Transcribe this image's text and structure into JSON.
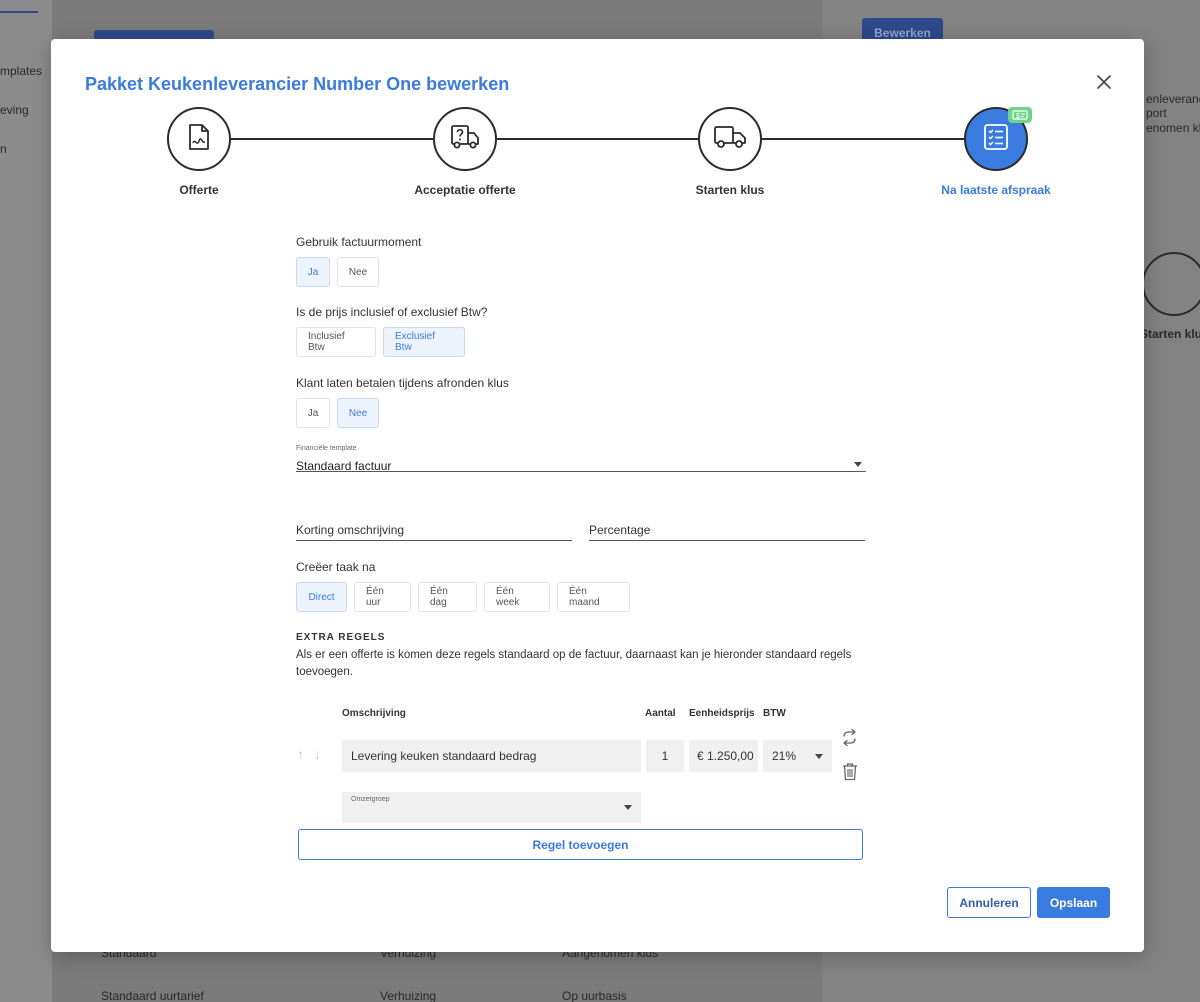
{
  "background": {
    "left_items": [
      "mplates",
      "eving",
      "n"
    ],
    "edit_button": "Bewerken",
    "right_lines": [
      "enleveranci",
      "port",
      "enomen klu"
    ],
    "right_step_label": "Starten klu",
    "bottom_rows": [
      [
        "Standaard",
        "Verhuizing",
        "Aangenomen klus"
      ],
      [
        "Standaard uurtarief",
        "Verhuizing",
        "Op uurbasis"
      ]
    ]
  },
  "modal": {
    "title": "Pakket Keukenleverancier Number One bewerken",
    "close_icon": "close-icon"
  },
  "steps": [
    {
      "label": "Offerte",
      "icon": "document-signature-icon",
      "active": false
    },
    {
      "label": "Acceptatie offerte",
      "icon": "question-truck-icon",
      "active": false
    },
    {
      "label": "Starten klus",
      "icon": "truck-icon",
      "active": false
    },
    {
      "label": "Na laatste afspraak",
      "icon": "checklist-icon",
      "active": true,
      "badge": "invoice-badge-icon"
    }
  ],
  "form": {
    "invoice_moment": {
      "label": "Gebruik factuurmoment",
      "options": [
        "Ja",
        "Nee"
      ],
      "selected": "Ja"
    },
    "vat": {
      "label": "Is de prijs inclusief of exclusief Btw?",
      "options": [
        "Inclusief Btw",
        "Exclusief Btw"
      ],
      "selected": "Exclusief Btw"
    },
    "pay_on_finish": {
      "label": "Klant laten betalen tijdens afronden klus",
      "options": [
        "Ja",
        "Nee"
      ],
      "selected": "Nee"
    },
    "financial_template": {
      "label": "Financiële template",
      "value": "Standaard factuur"
    },
    "discount_description": {
      "placeholder": "Korting omschrijving"
    },
    "percentage": {
      "placeholder": "Percentage"
    },
    "create_task": {
      "label": "Creëer taak na",
      "options": [
        "Direct",
        "Één uur",
        "Één dag",
        "Één week",
        "Één maand"
      ],
      "selected": "Direct"
    }
  },
  "extra_rules": {
    "title": "EXTRA REGELS",
    "description": "Als er een offerte is komen deze regels standaard op de factuur, daarnaast kan je hieronder standaard regels toevoegen.",
    "columns": [
      "Omschrijving",
      "Aantal",
      "Eenheidsprijs",
      "BTW"
    ],
    "rows": [
      {
        "description": "Levering keuken standaard bedrag",
        "quantity": "1",
        "unit_price": "€ 1.250,00",
        "vat": "21%",
        "revenue_group_label": "Omzetgroep"
      }
    ],
    "add_button": "Regel toevoegen"
  },
  "footer": {
    "cancel": "Annuleren",
    "save": "Opslaan"
  },
  "colors": {
    "accent": "#3a7be0",
    "badge": "#6fd38a"
  }
}
